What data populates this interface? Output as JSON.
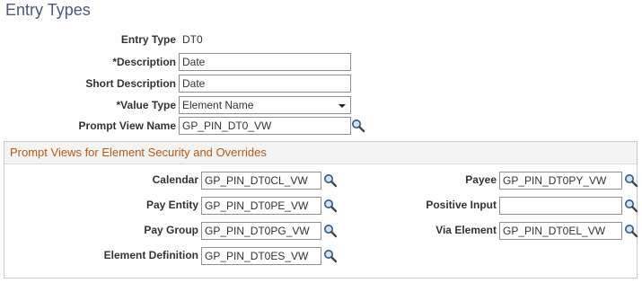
{
  "page": {
    "title": "Entry Types"
  },
  "form": {
    "entry_type": {
      "label": "Entry Type",
      "value": "DT0"
    },
    "description": {
      "label": "*Description",
      "value": "Date"
    },
    "short_description": {
      "label": "Short Description",
      "value": "Date"
    },
    "value_type": {
      "label": "*Value Type",
      "value": "Element Name"
    },
    "prompt_view_name": {
      "label": "Prompt View Name",
      "value": "GP_PIN_DT0_VW"
    }
  },
  "group": {
    "title": "Prompt Views for Element Security and Overrides",
    "calendar": {
      "label": "Calendar",
      "value": "GP_PIN_DT0CL_VW"
    },
    "pay_entity": {
      "label": "Pay Entity",
      "value": "GP_PIN_DT0PE_VW"
    },
    "pay_group": {
      "label": "Pay Group",
      "value": "GP_PIN_DT0PG_VW"
    },
    "element_definition": {
      "label": "Element Definition",
      "value": "GP_PIN_DT0ES_VW"
    },
    "payee": {
      "label": "Payee",
      "value": "GP_PIN_DT0PY_VW"
    },
    "positive_input": {
      "label": "Positive Input",
      "value": ""
    },
    "via_element": {
      "label": "Via Element",
      "value": "GP_PIN_DT0EL_VW"
    }
  },
  "icons": {
    "lookup": "magnifier-icon"
  },
  "colors": {
    "title": "#4a5a7a",
    "group_title": "#b45a16"
  }
}
